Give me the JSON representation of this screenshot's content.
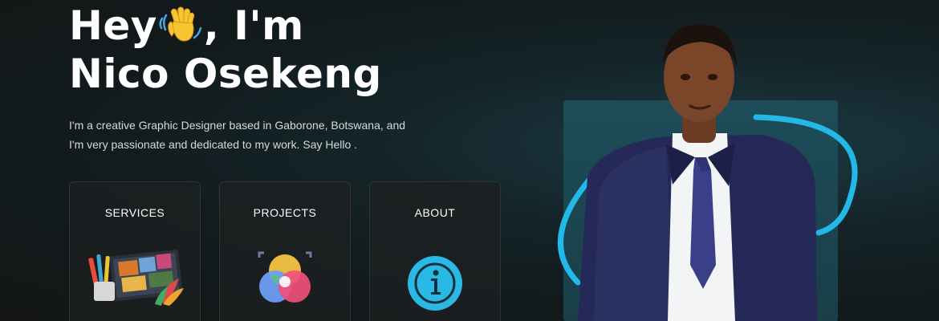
{
  "hero": {
    "line1_before": "Hey",
    "line1_after": ", I'm",
    "line2": "Nico Osekeng",
    "intro": "I'm a creative Graphic Designer based in Gaborone, Botswana, and I'm very passionate and dedicated to my work. Say Hello ."
  },
  "cards": [
    {
      "label": "SERVICES",
      "icon": "design-tools-icon"
    },
    {
      "label": "PROJECTS",
      "icon": "color-wheel-icon"
    },
    {
      "label": "ABOUT",
      "icon": "info-icon"
    }
  ],
  "colors": {
    "background": "#141616",
    "panel": "#1d4c58",
    "accent_ring": "#22b8e8",
    "info_icon": "#29b9e4"
  }
}
